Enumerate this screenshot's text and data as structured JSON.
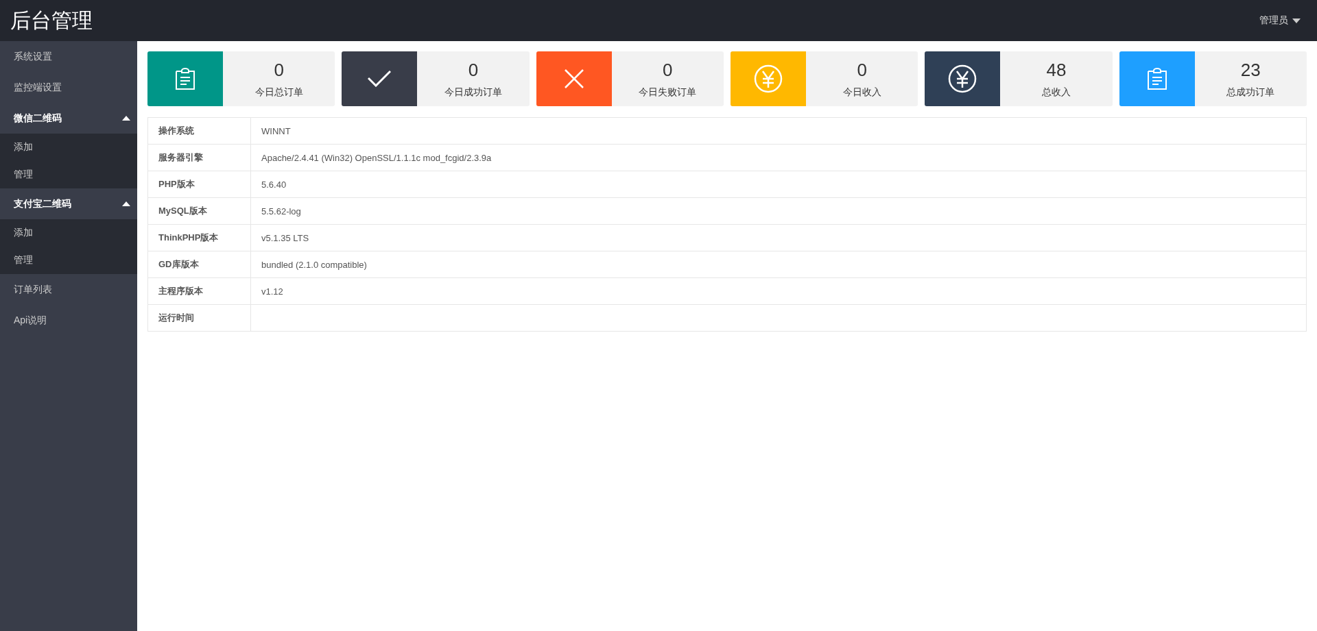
{
  "header": {
    "title": "后台管理",
    "user": "管理员"
  },
  "sidebar": {
    "items": [
      {
        "label": "系统设置"
      },
      {
        "label": "监控端设置"
      },
      {
        "label": "微信二维码",
        "expanded": true,
        "children": [
          {
            "label": "添加"
          },
          {
            "label": "管理"
          }
        ]
      },
      {
        "label": "支付宝二维码",
        "expanded": true,
        "children": [
          {
            "label": "添加"
          },
          {
            "label": "管理"
          }
        ]
      },
      {
        "label": "订单列表"
      },
      {
        "label": "Api说明"
      }
    ]
  },
  "stats": [
    {
      "value": "0",
      "label": "今日总订单",
      "kind": "clipboard",
      "color": "#009688"
    },
    {
      "value": "0",
      "label": "今日成功订单",
      "kind": "check",
      "color": "#393d49"
    },
    {
      "value": "0",
      "label": "今日失败订单",
      "kind": "cross",
      "color": "#ff5722"
    },
    {
      "value": "0",
      "label": "今日收入",
      "kind": "yen",
      "color": "#ffb800"
    },
    {
      "value": "48",
      "label": "总收入",
      "kind": "yen",
      "color": "#2f4056"
    },
    {
      "value": "23",
      "label": "总成功订单",
      "kind": "clipboard",
      "color": "#1e9fff"
    }
  ],
  "info_table": {
    "rows": [
      {
        "name": "操作系统",
        "value": "WINNT"
      },
      {
        "name": "服务器引擎",
        "value": "Apache/2.4.41 (Win32) OpenSSL/1.1.1c mod_fcgid/2.3.9a"
      },
      {
        "name": "PHP版本",
        "value": "5.6.40"
      },
      {
        "name": "MySQL版本",
        "value": "5.5.62-log"
      },
      {
        "name": "ThinkPHP版本",
        "value": "v5.1.35 LTS"
      },
      {
        "name": "GD库版本",
        "value": "bundled (2.1.0 compatible)"
      },
      {
        "name": "主程序版本",
        "value": "v1.12"
      },
      {
        "name": "运行时间",
        "value": ""
      }
    ]
  }
}
